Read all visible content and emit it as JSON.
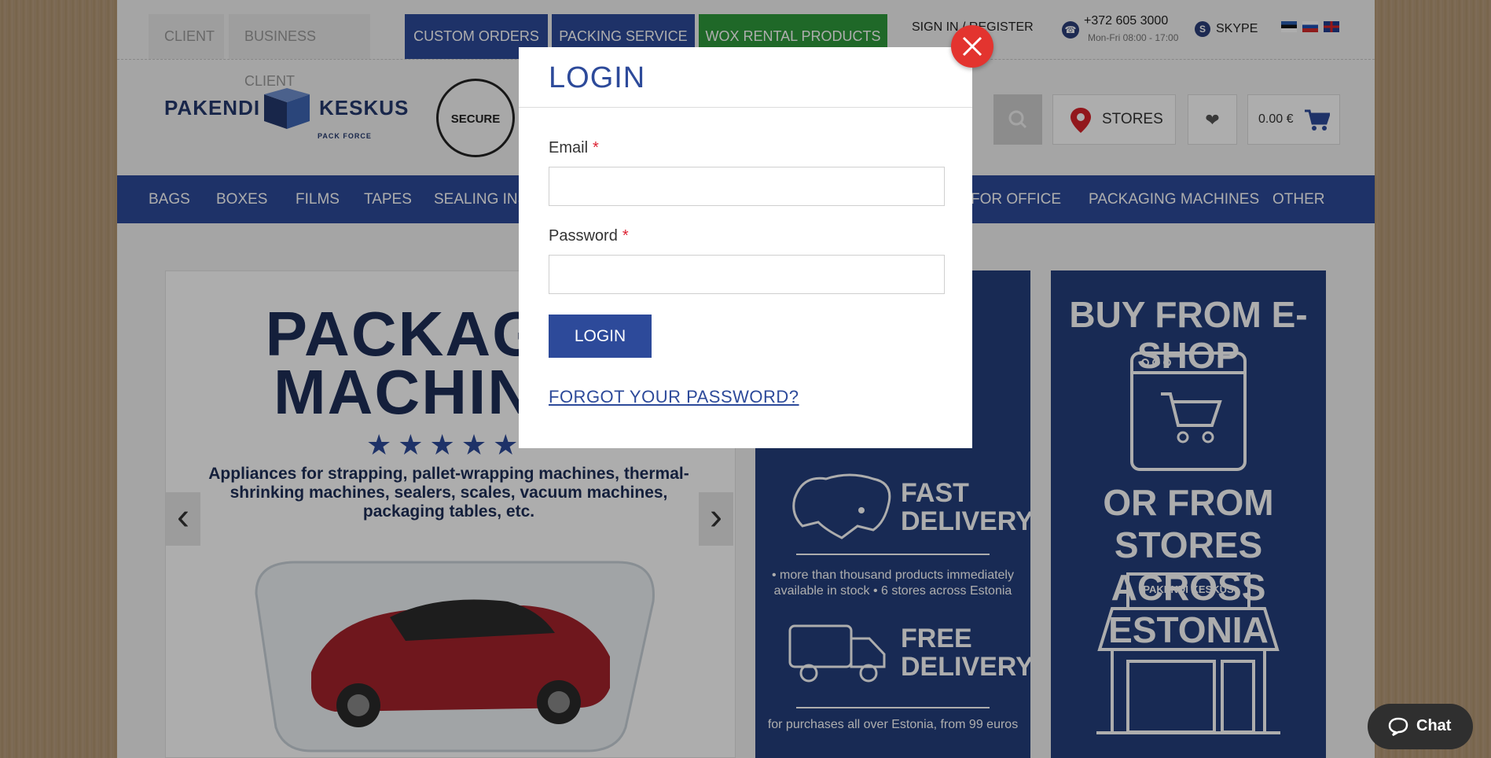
{
  "topbar": {
    "client_tabs": [
      "CLIENT",
      "BUSINESS CLIENT"
    ],
    "nav_buttons": [
      "CUSTOM ORDERS",
      "PACKING SERVICE",
      "WOX RENTAL PRODUCTS"
    ],
    "signin": "SIGN IN / REGISTER",
    "phone": "+372 605 3000",
    "hours": "Mon-Fri 08:00 - 17:00",
    "skype": "SKYPE"
  },
  "header": {
    "logo_left": "PAKENDI",
    "logo_right": "KESKUS",
    "logo_sub": "PACK    FORCE",
    "seal_text": "SECURE",
    "stores": "STORES",
    "cart_total": "0.00 €"
  },
  "mainnav": {
    "items": [
      "BAGS",
      "BOXES",
      "FILMS",
      "TAPES",
      "SEALING INST",
      "FOR OFFICE",
      "PACKAGING MACHINES",
      "OTHER"
    ]
  },
  "slider": {
    "title_line1": "PACKAG",
    "title_line2": "MACHIN",
    "description": "Appliances for strapping, pallet-wrapping machines, thermal-shrinking machines, sealers, scales, vacuum machines, packaging tables, etc."
  },
  "banner_delivery": {
    "fast": "FAST DELIVERY",
    "fast_note": "• more than thousand products immediately available in stock • 6 stores across Estonia",
    "free": "FREE DELIVERY",
    "free_note": "for purchases all over Estonia, from 99 euros"
  },
  "banner_shop": {
    "title1": "BUY FROM E-SHOP",
    "title2": "OR FROM STORES ACROSS ESTONIA",
    "sign": "PAKENDI   KESKUS"
  },
  "modal": {
    "title": "LOGIN",
    "email_label": "Email",
    "password_label": "Password",
    "required_mark": "*",
    "email_value": "",
    "password_value": "",
    "login_button": "LOGIN",
    "forgot_link": "FORGOT YOUR PASSWORD?"
  },
  "chat": {
    "label": "Chat"
  },
  "colors": {
    "brand_blue": "#2d4a9a",
    "green": "#2f9a3c",
    "close_red": "#e3342f"
  }
}
